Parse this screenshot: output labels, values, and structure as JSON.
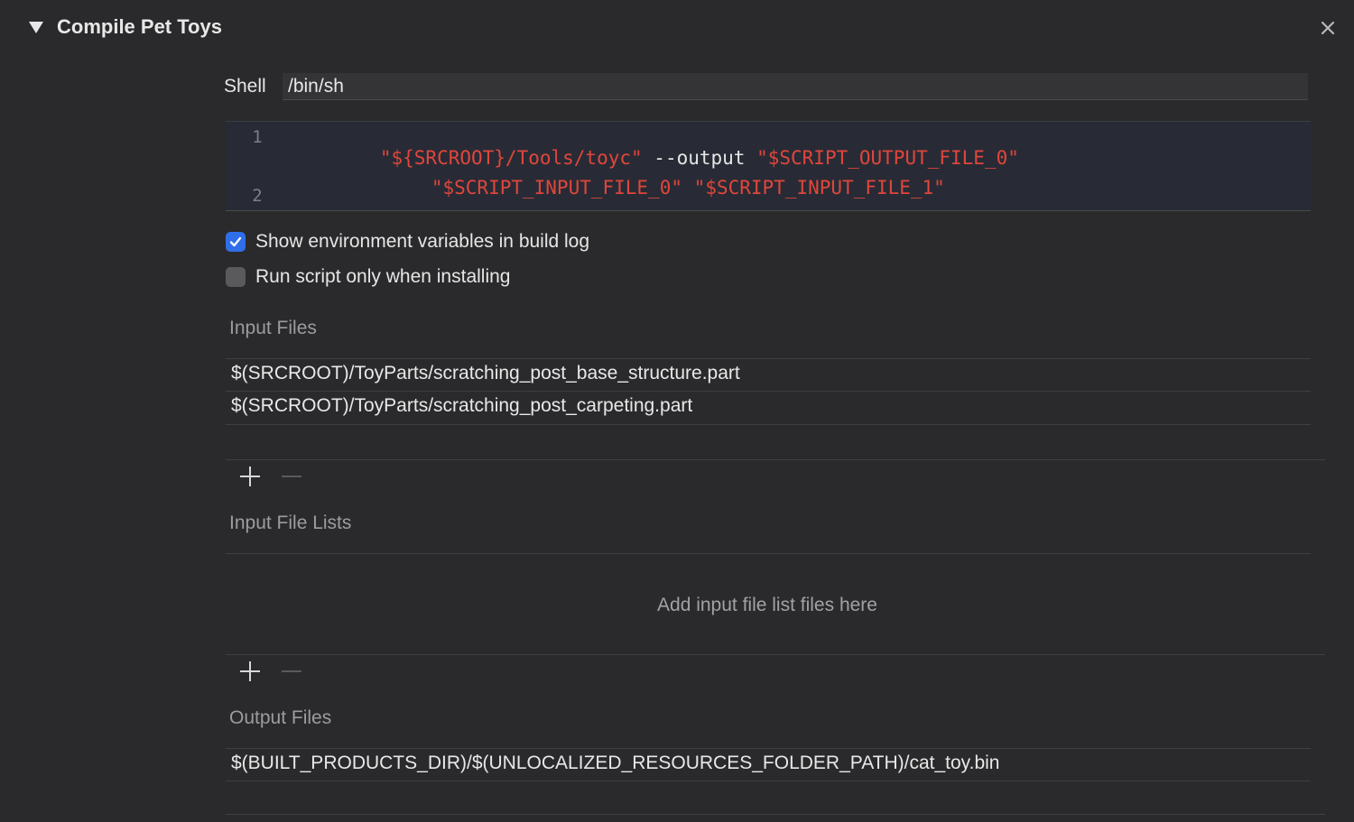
{
  "header": {
    "title": "Compile Pet Toys"
  },
  "shell": {
    "label": "Shell",
    "value": "/bin/sh"
  },
  "script": {
    "line_numbers": [
      "1",
      "2"
    ],
    "line1": {
      "tok1": "\"${SRCROOT}/Tools/toyc\"",
      "tok2": " --output ",
      "tok3": "\"$SCRIPT_OUTPUT_FILE_0\""
    },
    "line1_wrap": {
      "tok1": "\"$SCRIPT_INPUT_FILE_0\"",
      "tok2": " ",
      "tok3": "\"$SCRIPT_INPUT_FILE_1\""
    }
  },
  "options": {
    "show_env": {
      "label": "Show environment variables in build log",
      "checked": true
    },
    "run_installing": {
      "label": "Run script only when installing",
      "checked": false
    }
  },
  "input_files": {
    "title": "Input Files",
    "items": [
      "$(SRCROOT)/ToyParts/scratching_post_base_structure.part",
      "$(SRCROOT)/ToyParts/scratching_post_carpeting.part"
    ]
  },
  "input_file_lists": {
    "title": "Input File Lists",
    "empty_hint": "Add input file list files here"
  },
  "output_files": {
    "title": "Output Files",
    "items": [
      "$(BUILT_PRODUCTS_DIR)/$(UNLOCALIZED_RESOURCES_FOLDER_PATH)/cat_toy.bin"
    ]
  },
  "colors": {
    "background": "#2a2a2c",
    "code_background": "#282b35",
    "string_token": "#e0463c",
    "checkbox_accent": "#2f6ee8"
  }
}
